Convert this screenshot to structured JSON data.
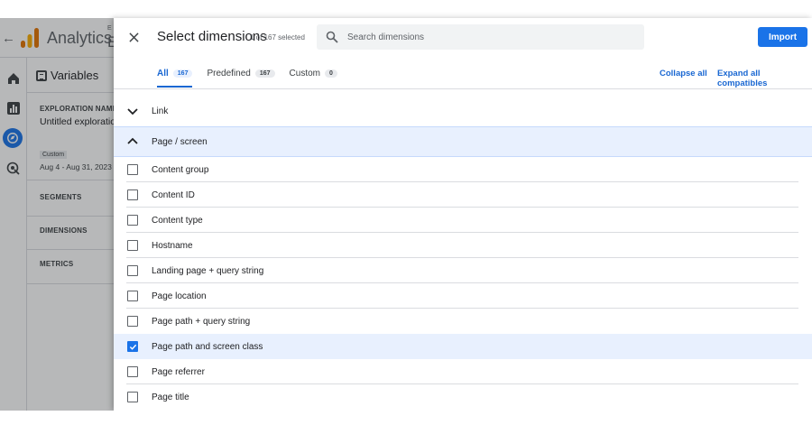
{
  "app": {
    "name": "Analytics",
    "crumb_small": "E",
    "crumb_big": "E",
    "variables_title": "Variables",
    "exploration_label": "EXPLORATION NAME:",
    "exploration_name": "Untitled exploration",
    "date_chip": "Custom",
    "date_range": "Aug 4 - Aug 31, 2023",
    "sections": [
      "SEGMENTS",
      "DIMENSIONS",
      "METRICS"
    ],
    "rail_icons": [
      "home-icon",
      "reports-icon",
      "explore-icon",
      "advertising-icon"
    ]
  },
  "drawer": {
    "title": "Select dimensions",
    "selection_count": "1 of 167 selected",
    "search_placeholder": "Search dimensions",
    "import_label": "Import",
    "tabs": [
      {
        "label": "All",
        "count": "167",
        "active": true
      },
      {
        "label": "Predefined",
        "count": "167",
        "active": false
      },
      {
        "label": "Custom",
        "count": "0",
        "active": false
      }
    ],
    "collapse_all": "Collapse all",
    "expand_all": "Expand all compatibles",
    "groups": [
      {
        "label": "Link",
        "expanded": false
      },
      {
        "label": "Page / screen",
        "expanded": true
      }
    ],
    "items": [
      {
        "label": "Content group",
        "checked": false
      },
      {
        "label": "Content ID",
        "checked": false
      },
      {
        "label": "Content type",
        "checked": false
      },
      {
        "label": "Hostname",
        "checked": false
      },
      {
        "label": "Landing page + query string",
        "checked": false
      },
      {
        "label": "Page location",
        "checked": false
      },
      {
        "label": "Page path + query string",
        "checked": false
      },
      {
        "label": "Page path and screen class",
        "checked": true
      },
      {
        "label": "Page referrer",
        "checked": false
      },
      {
        "label": "Page title",
        "checked": false
      }
    ]
  },
  "colors": {
    "accent": "#1a73e8",
    "selected_row": "#e8f0fe",
    "scrim": "#5f6368"
  }
}
